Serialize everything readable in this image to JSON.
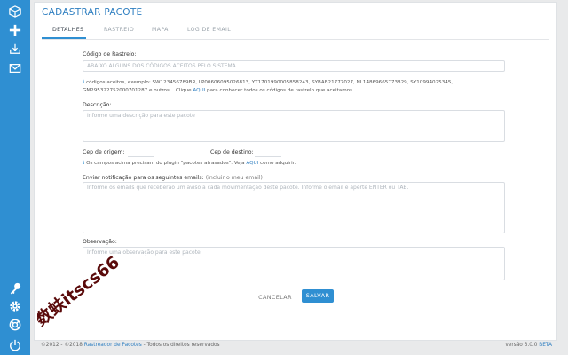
{
  "sidebar": {
    "icons": [
      "box-icon",
      "plus-icon",
      "download-icon",
      "mail-icon",
      "key-icon",
      "gear-icon",
      "lifebuoy-icon",
      "power-icon"
    ]
  },
  "page": {
    "title": "CADASTRAR PACOTE",
    "tabs": [
      "DETALHES",
      "RASTREIO",
      "MAPA",
      "LOG DE EMAIL"
    ]
  },
  "form": {
    "tracking_label": "Código de Rastreio:",
    "tracking_placeholder": "ABAIXO ALGUNS DOS CÓDIGOS ACEITOS PELO SISTEMA",
    "tracking_help_1": "códigos aceitos, exemplo: SW123456789BR, LP00606095026813, YT1701990005858243, SYBAB21777027, NL14869665773829, SY10994025345,",
    "tracking_help_2a": "GM295322752000701287 e outros... Clique ",
    "tracking_help_link": "AQUI",
    "tracking_help_2b": " para conhecer todos os códigos de rastrelo que aceitamos.",
    "description_label": "Descrição:",
    "description_placeholder": "Informe uma descrição para este pacote",
    "origin_label": "Cep de origem:",
    "dest_label": "Cep de destino:",
    "plugin_help_a": "Os campos acima precisam do plugin \"pacotes atrasados\". Veja ",
    "plugin_help_link": "AQUI",
    "plugin_help_b": " como adquirir.",
    "notify_label": "Enviar notificação para os seguintes emails:",
    "notify_hint": "(incluir o meu email)",
    "notify_placeholder": "Informe os emails que receberão um aviso a cada movimentação deste pacote. Informe o email e aperte ENTER ou TAB.",
    "obs_label": "Observação:",
    "obs_placeholder": "Informe uma observação para este pacote"
  },
  "actions": {
    "cancel": "CANCELAR",
    "save": "SALVAR"
  },
  "footer": {
    "copyright": "©2012 - ©2018 ",
    "brand": "Rastreador de Pacotes",
    "rights": " - Todos os direitos reservados",
    "version_prefix": "versão 3.0.0 ",
    "version_beta": "BETA"
  },
  "watermark_text": "数蚨itscs66",
  "colors": {
    "sidebar": "#2f8fd2",
    "accent": "#2f7fc1",
    "save_button": "#2f8fd2",
    "watermark": "#5a0a0a"
  }
}
